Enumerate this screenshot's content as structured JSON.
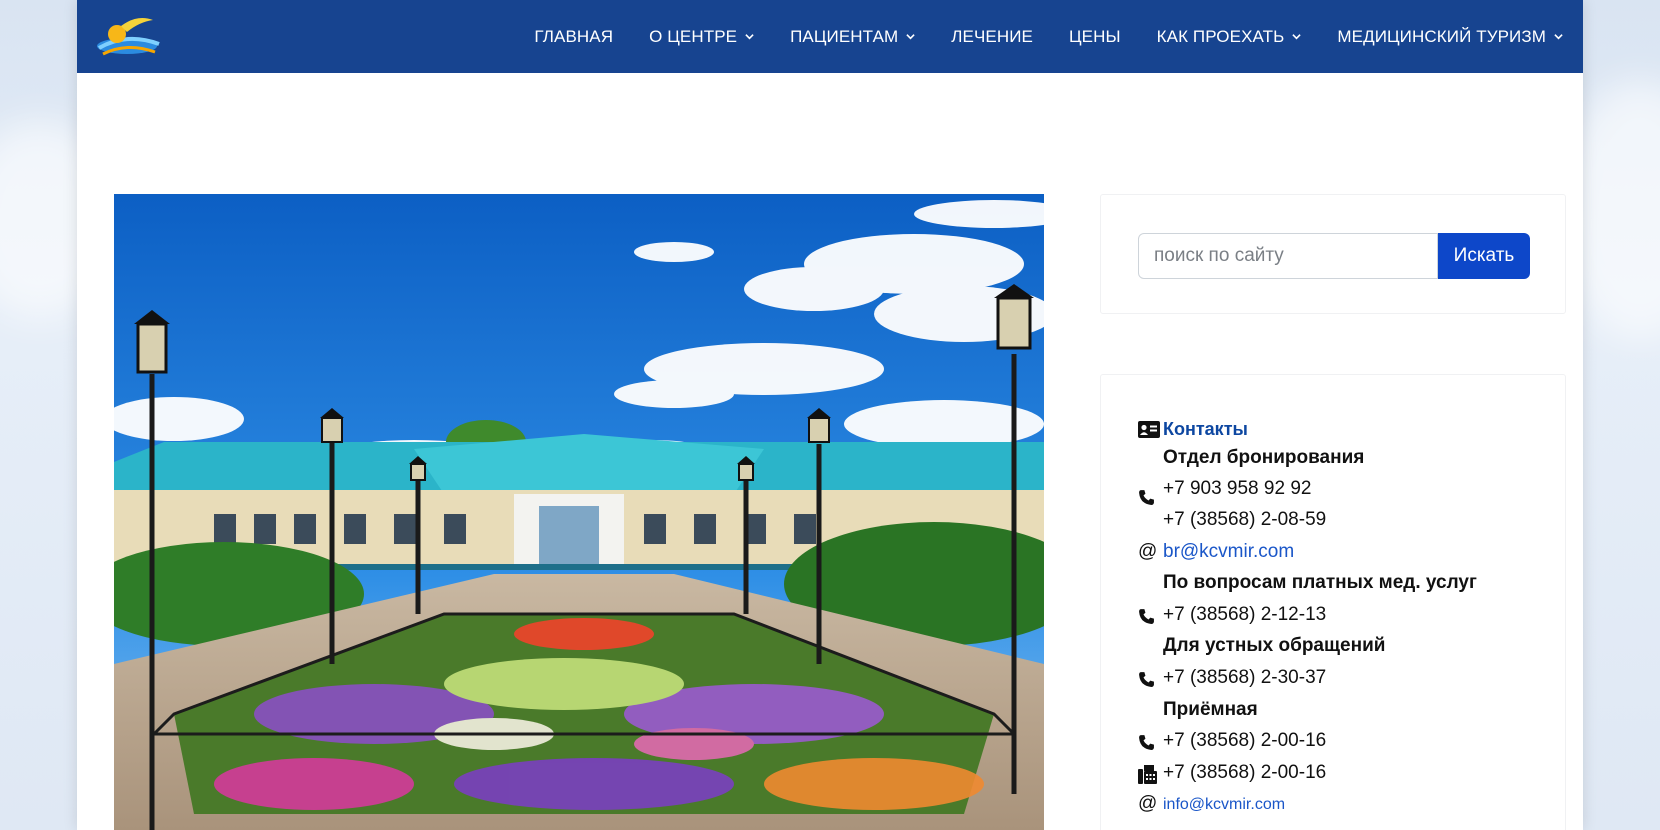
{
  "nav": {
    "items": [
      {
        "label": "ГЛАВНАЯ",
        "dropdown": false
      },
      {
        "label": "О ЦЕНТРЕ",
        "dropdown": true
      },
      {
        "label": "ПАЦИЕНТАМ",
        "dropdown": true
      },
      {
        "label": "ЛЕЧЕНИЕ",
        "dropdown": false
      },
      {
        "label": "ЦЕНЫ",
        "dropdown": false
      },
      {
        "label": "КАК ПРОЕХАТЬ",
        "dropdown": true
      },
      {
        "label": "МЕДИЦИНСКИЙ ТУРИЗМ",
        "dropdown": true
      }
    ]
  },
  "search": {
    "placeholder": "поиск по сайту",
    "button_label": "Искать"
  },
  "contacts": {
    "title": "Контакты",
    "booking_heading": "Отдел бронирования",
    "booking_phone_1": "+7 903 958 92 92",
    "booking_phone_2": "+7 (38568) 2-08-59",
    "booking_email": "br@kcvmir.com",
    "paid_heading": "По вопросам платных мед. услуг",
    "paid_phone": "+7 (38568) 2-12-13",
    "oral_heading": "Для устных обращений",
    "oral_phone": "+7 (38568) 2-30-37",
    "reception_heading": "Приёмная",
    "reception_phone": "+7 (38568) 2-00-16",
    "reception_fax": "+7 (38568) 2-00-16",
    "reception_email": "info@kcvmir.com"
  },
  "colors": {
    "navbar": "#174490",
    "accent": "#0d47c9",
    "link": "#1a56c8"
  },
  "icons": {
    "contacts": "address-card-icon",
    "phone": "phone-icon",
    "email": "at-icon",
    "fax": "fax-icon",
    "dropdown": "chevron-down-icon"
  }
}
